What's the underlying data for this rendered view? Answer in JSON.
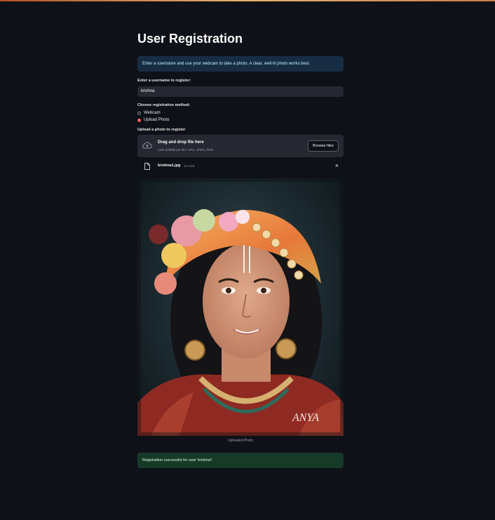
{
  "page": {
    "title": "User Registration",
    "info_message": "Enter a username and use your webcam to take a photo. A clear, well-lit photo works best."
  },
  "username": {
    "label": "Enter a username to register:",
    "value": "krishna"
  },
  "method": {
    "label": "Choose registration method:",
    "options": [
      "Webcam",
      "Upload Photo"
    ],
    "selected": "Upload Photo"
  },
  "upload": {
    "label": "Upload a photo to register",
    "drop_title": "Drag and drop file here",
    "drop_subtitle": "Limit 200MB per file • JPG, JPEG, PNG",
    "browse_label": "Browse files",
    "icon": "cloud-upload-icon"
  },
  "file": {
    "name": "krishna1.jpg",
    "size": "137.9KB",
    "close_glyph": "×",
    "icon": "file-icon"
  },
  "image": {
    "caption": "Uploaded Photo",
    "watermark": "ANYA"
  },
  "status": {
    "success_message": "Registration successful for user 'krishna'!"
  },
  "colors": {
    "background": "#0e1117",
    "input_bg": "#262730",
    "info_bg": "#172d43",
    "success_bg": "#173928",
    "accent": "#ff4b4b"
  }
}
